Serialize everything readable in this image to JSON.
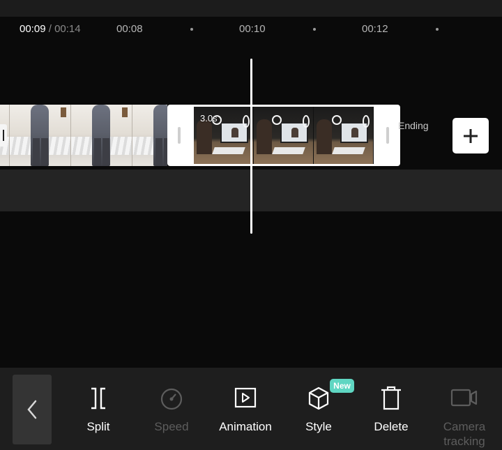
{
  "ruler": {
    "current_time": "00:09",
    "separator": "/",
    "total_time": "00:14",
    "ticks": [
      "00:08",
      "00:10",
      "00:12"
    ]
  },
  "timeline": {
    "clip2_duration": "3.0s",
    "ending_label": "Ending"
  },
  "toolbar": {
    "back_icon": "chevron-left-icon",
    "tools": [
      {
        "id": "split",
        "label": "Split",
        "icon": "split-icon",
        "enabled": true
      },
      {
        "id": "speed",
        "label": "Speed",
        "icon": "speedometer-icon",
        "enabled": false
      },
      {
        "id": "animation",
        "label": "Animation",
        "icon": "animation-icon",
        "enabled": true
      },
      {
        "id": "style",
        "label": "Style",
        "icon": "cube-icon",
        "enabled": true,
        "badge": "New"
      },
      {
        "id": "delete",
        "label": "Delete",
        "icon": "trash-icon",
        "enabled": true
      },
      {
        "id": "camera-tracking",
        "label": "Camera tracking",
        "icon": "camera-icon",
        "enabled": false
      }
    ]
  },
  "colors": {
    "background": "#0a0a0a",
    "toolbar": "#1e1e1e",
    "badge": "#5fd6c2",
    "disabled_text": "#5d5d5d"
  }
}
